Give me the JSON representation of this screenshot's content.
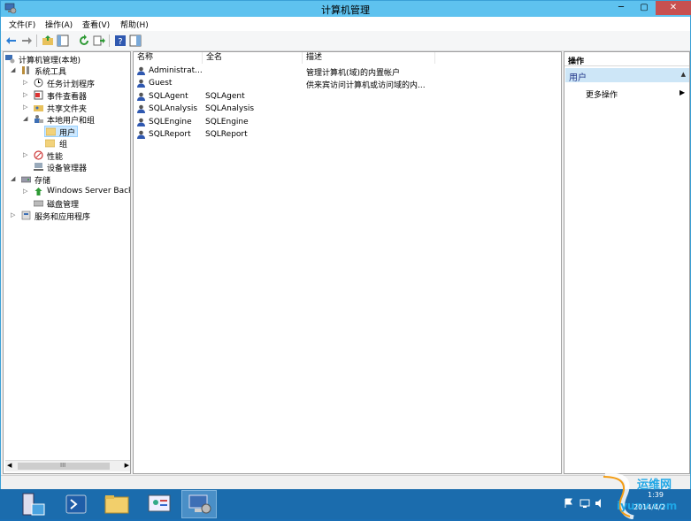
{
  "window": {
    "title": "计算机管理",
    "buttons": [
      "─",
      "▢",
      "✕"
    ]
  },
  "menu": [
    "文件(F)",
    "操作(A)",
    "查看(V)",
    "帮助(H)"
  ],
  "tree": [
    {
      "label": "计算机管理(本地)",
      "expanded": true
    },
    {
      "label": "系统工具",
      "expanded": true
    },
    {
      "label": "任务计划程序",
      "expanded": false
    },
    {
      "label": "事件查看器",
      "expanded": false
    },
    {
      "label": "共享文件夹",
      "expanded": false
    },
    {
      "label": "本地用户和组",
      "expanded": true
    },
    {
      "label": "用户",
      "selected": true
    },
    {
      "label": "组"
    },
    {
      "label": "性能",
      "expanded": false
    },
    {
      "label": "设备管理器"
    },
    {
      "label": "存储",
      "expanded": true
    },
    {
      "label": "Windows Server Back",
      "expanded": false
    },
    {
      "label": "磁盘管理"
    },
    {
      "label": "服务和应用程序",
      "expanded": false
    }
  ],
  "list": {
    "columns": [
      "名称",
      "全名",
      "描述"
    ],
    "rows": [
      {
        "name": "Administrat...",
        "full": "",
        "desc": "管理计算机(域)的内置帐户"
      },
      {
        "name": "Guest",
        "full": "",
        "desc": "供来宾访问计算机或访问域的内..."
      },
      {
        "name": "SQLAgent",
        "full": "SQLAgent",
        "desc": ""
      },
      {
        "name": "SQLAnalysis",
        "full": "SQLAnalysis",
        "desc": ""
      },
      {
        "name": "SQLEngine",
        "full": "SQLEngine",
        "desc": ""
      },
      {
        "name": "SQLReport",
        "full": "SQLReport",
        "desc": ""
      }
    ]
  },
  "actions": {
    "header": "操作",
    "section": "用户",
    "item": "更多操作"
  },
  "scrollbar": {
    "thumb": "III"
  },
  "taskbar": {
    "time": "1:39",
    "date": "2014/4/2",
    "watermark_cn": "运维网",
    "watermark_en": "iyunv.com"
  }
}
